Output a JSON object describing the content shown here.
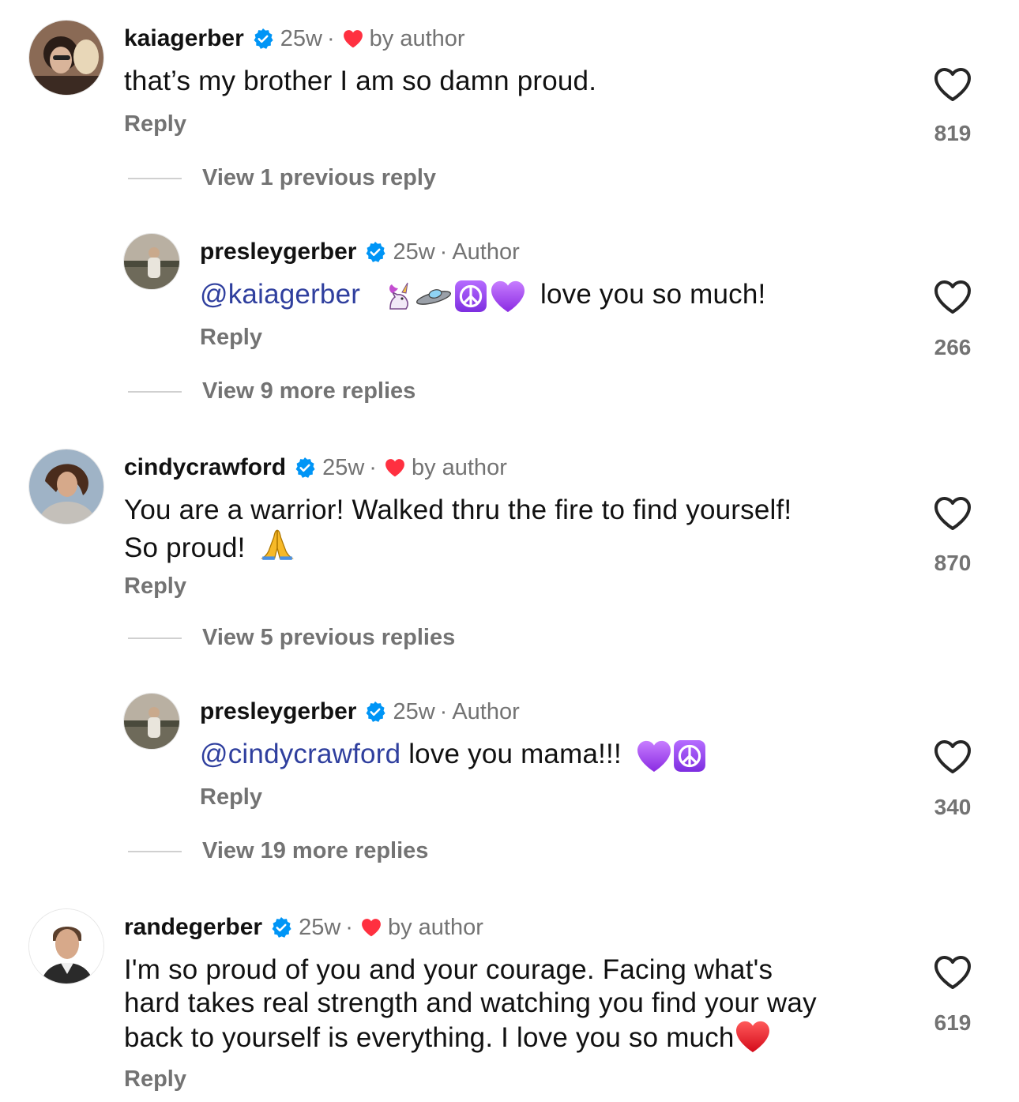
{
  "comments": [
    {
      "username": "kaiagerber",
      "time": "25w",
      "tag": "by author",
      "text": "that’s my brother I am so damn proud.",
      "reply": "Reply",
      "likes": "819",
      "view_more": "View 1 previous reply"
    },
    {
      "username": "presleygerber",
      "time": "25w",
      "tag": "Author",
      "mention": "@kaiagerber",
      "text": "love you so much!",
      "reply": "Reply",
      "likes": "266",
      "view_more": "View 9 more replies"
    },
    {
      "username": "cindycrawford",
      "time": "25w",
      "tag": "by author",
      "text_line1": "You are a warrior!  Walked thru the fire to find yourself!",
      "text_line2": "So proud!",
      "reply": "Reply",
      "likes": "870",
      "view_more": "View 5 previous replies"
    },
    {
      "username": "presleygerber",
      "time": "25w",
      "tag": "Author",
      "mention": "@cindycrawford",
      "text": "love you mama!!!",
      "reply": "Reply",
      "likes": "340",
      "view_more": "View 19 more replies"
    },
    {
      "username": "randegerber",
      "time": "25w",
      "tag": "by author",
      "text_line1": "I'm so proud of you and your courage. Facing what's",
      "text_line2": "hard takes real strength and watching you find your way",
      "text_line3": "back to yourself is everything. I love you so much",
      "reply": "Reply",
      "likes": "619"
    }
  ],
  "colors": {
    "verified": "#0095f6",
    "heart_red": "#ff3040",
    "muted": "#737373",
    "mention": "#2f3f9e"
  },
  "icons": [
    "verified-badge-icon",
    "red-heart-icon",
    "like-heart-outline-icon",
    "unicorn-emoji-icon",
    "ufo-emoji-icon",
    "peace-symbol-emoji-icon",
    "purple-heart-emoji-icon",
    "folded-hands-emoji-icon"
  ]
}
